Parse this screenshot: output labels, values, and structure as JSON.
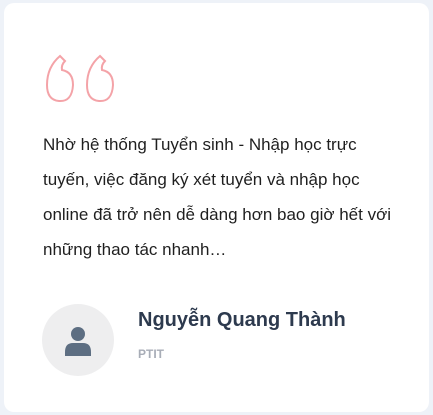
{
  "testimonial": {
    "quote_icon": "quote-open-icon",
    "quote_color": "#f4a3a8",
    "text": "Nhờ hệ thống Tuyển sinh - Nhập học trực tuyến, việc đăng ký xét tuyển và nhập học online đã trở nên dễ dàng hơn bao giờ hết với những thao tác nhanh…",
    "author": {
      "avatar_icon": "user-icon",
      "name": "Nguyễn Quang Thành",
      "organization": "PTIT"
    }
  }
}
